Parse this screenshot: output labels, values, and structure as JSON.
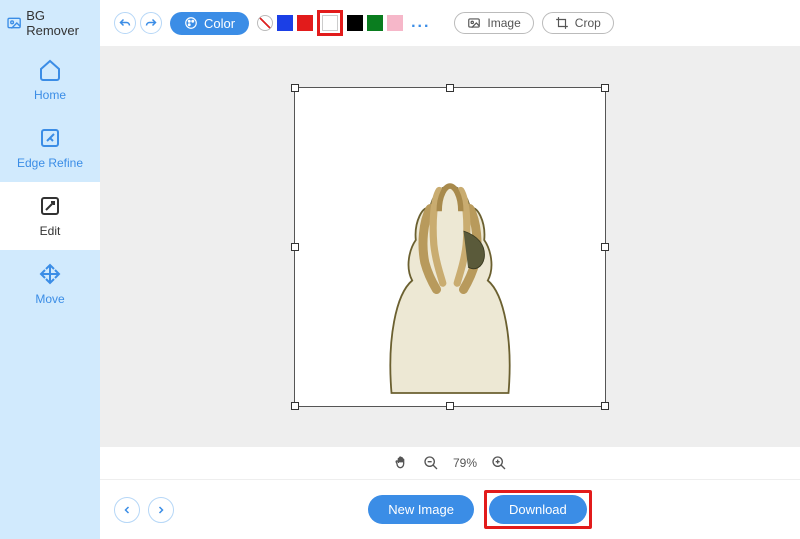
{
  "app": {
    "title": "BG Remover"
  },
  "sidebar": {
    "items": [
      {
        "label": "Home",
        "icon": "home-icon"
      },
      {
        "label": "Edge Refine",
        "icon": "edge-refine-icon"
      },
      {
        "label": "Edit",
        "icon": "edit-icon"
      },
      {
        "label": "Move",
        "icon": "move-icon"
      }
    ],
    "active_index": 2
  },
  "toolbar": {
    "color_label": "Color",
    "image_label": "Image",
    "crop_label": "Crop",
    "more_colors": "...",
    "swatches": [
      "transparent",
      "#1b3fe6",
      "#e21b1b",
      "#ffffff",
      "#000000",
      "#0a7d1f",
      "#f6b7c9"
    ],
    "highlighted_swatch_index": 3
  },
  "zoom": {
    "level": "79%"
  },
  "bottom": {
    "new_image_label": "New Image",
    "download_label": "Download"
  }
}
